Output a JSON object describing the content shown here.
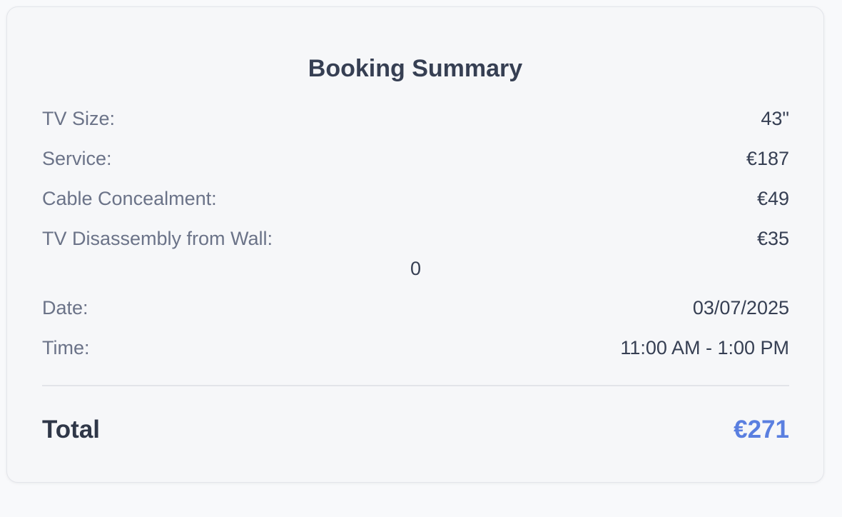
{
  "summary": {
    "title": "Booking Summary",
    "rows": [
      {
        "label": "TV Size:",
        "value": "43\""
      },
      {
        "label": "Service:",
        "value": "€187"
      },
      {
        "label": "Cable Concealment:",
        "value": "€49"
      },
      {
        "label": "TV Disassembly from Wall:",
        "value": "€35"
      }
    ],
    "extra_value": "0",
    "schedule": [
      {
        "label": "Date:",
        "value": "03/07/2025"
      },
      {
        "label": "Time:",
        "value": "11:00 AM - 1:00 PM"
      }
    ],
    "total_label": "Total",
    "total_value": "€271"
  },
  "colors": {
    "accent": "#5a7fe0",
    "text_primary": "#363f53",
    "text_secondary": "#6b7388"
  }
}
